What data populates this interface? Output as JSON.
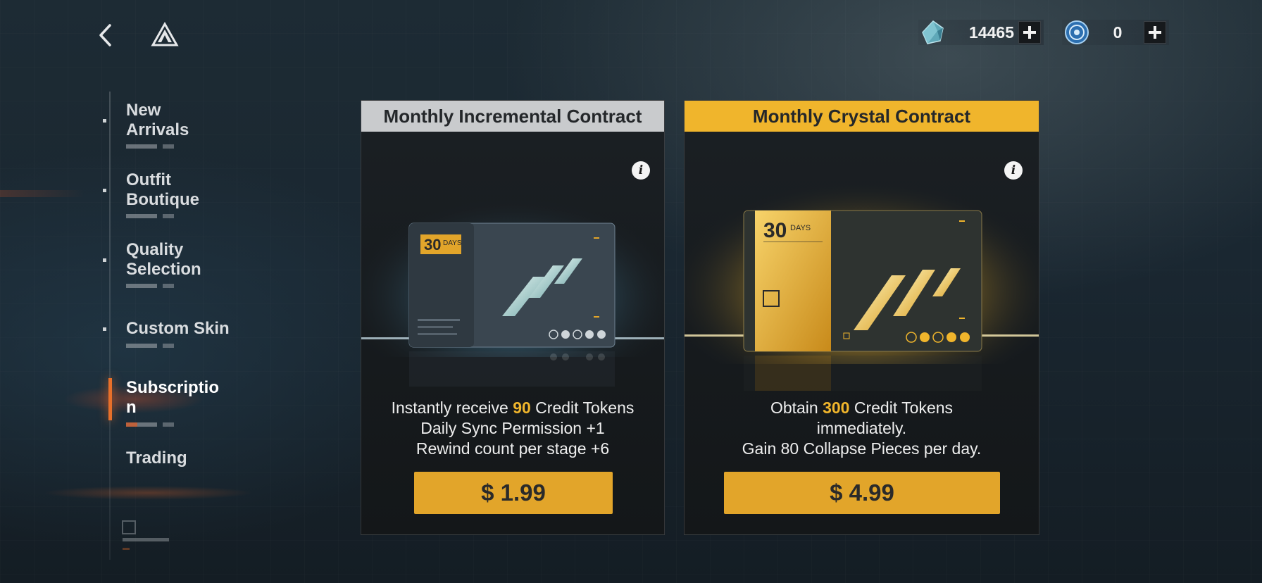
{
  "topbar": {
    "back_icon": "chevron-left-icon",
    "logo_icon": "triangle-logo-icon",
    "currencies": [
      {
        "icon": "crystal-icon",
        "amount": "14465",
        "plus": "+"
      },
      {
        "icon": "coin-icon",
        "amount": "0",
        "plus": "+"
      }
    ]
  },
  "sidebar": {
    "items": [
      {
        "label_line1": "New",
        "label_line2": "Arrivals"
      },
      {
        "label_line1": "Outfit",
        "label_line2": "Boutique"
      },
      {
        "label_line1": "Quality",
        "label_line2": "Selection"
      },
      {
        "label_line1": "Custom Skin",
        "label_line2": ""
      },
      {
        "label_line1": "Subscriptio",
        "label_line2": "n",
        "active": true
      },
      {
        "label_line1": "Trading",
        "label_line2": ""
      }
    ]
  },
  "cards": [
    {
      "title": "Monthly Incremental Contract",
      "theme": "silver",
      "header_color": "#c9cbcd",
      "days_number": "30",
      "days_label": "DAYS",
      "desc_line1_pre": "Instantly receive ",
      "desc_line1_hl": "90",
      "desc_line1_post": " Credit Tokens",
      "desc_line2": "Daily Sync Permission +1",
      "desc_line3": "Rewind count per stage +6",
      "price": "$ 1.99"
    },
    {
      "title": "Monthly Crystal Contract",
      "theme": "gold",
      "header_color": "#f0b52c",
      "days_number": "30",
      "days_label": "DAYS",
      "desc_line1_pre": "Obtain ",
      "desc_line1_hl": "300",
      "desc_line1_post": " Credit Tokens",
      "desc_line2": "immediately.",
      "desc_line3": "Gain 80 Collapse Pieces per day.",
      "price": "$ 4.99"
    }
  ],
  "colors": {
    "accent_orange": "#e8702a",
    "gold": "#f0b52c",
    "price_button": "#e2a52a"
  }
}
